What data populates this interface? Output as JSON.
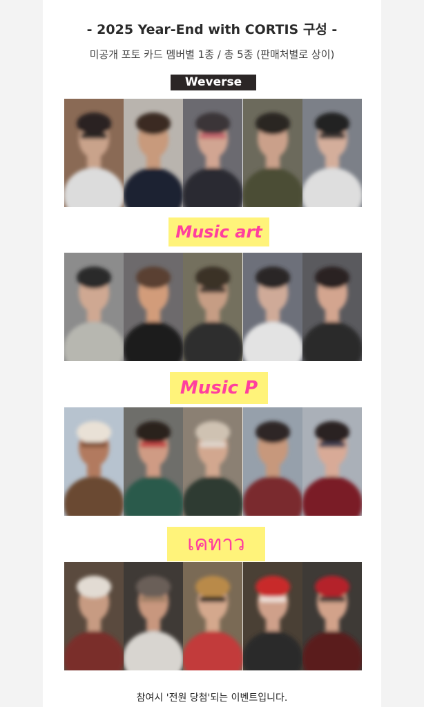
{
  "title": "- 2025 Year-End with CORTIS 구성 -",
  "subtitle": "미공개 포토 카드 멤버별 1종 / 총 5종 (판매처별로 상이)",
  "sections": [
    {
      "label": "Weverse"
    },
    {
      "label": "Music art"
    },
    {
      "label": "Music P"
    },
    {
      "label": "เคทาว"
    }
  ],
  "footer": "참여시 '전원 당첨'되는 이벤트입니다.",
  "colors": {
    "label_bg": "#fff37a",
    "label_text": "#ff3f9e",
    "weverse_bg": "#2b2626"
  },
  "photos": {
    "row1": [
      {
        "bg": "#8a6a55",
        "skin": "#c9a38b",
        "hair": "#2a2320",
        "cloth": "#dcdcdc",
        "extra": "#111"
      },
      {
        "bg": "#b9b4ae",
        "skin": "#c89a7c",
        "hair": "#3a2c22",
        "cloth": "#1d2030",
        "extra": ""
      },
      {
        "bg": "#6b6a70",
        "skin": "#d1a592",
        "hair": "#3b3437",
        "cloth": "#2a2b33",
        "extra": "#c05a66"
      },
      {
        "bg": "#6c6a5c",
        "skin": "#caa08a",
        "hair": "#2b2520",
        "cloth": "#4c4d36",
        "extra": ""
      },
      {
        "bg": "#7c8088",
        "skin": "#d4ae9b",
        "hair": "#222",
        "cloth": "#dedede",
        "extra": "#222"
      }
    ],
    "row2": [
      {
        "bg": "#8c8c8c",
        "skin": "#cfa892",
        "hair": "#2a2a2a",
        "cloth": "#b7b7b0",
        "extra": ""
      },
      {
        "bg": "#6d6a6c",
        "skin": "#d29c7a",
        "hair": "#5a4030",
        "cloth": "#1a1a1a",
        "extra": ""
      },
      {
        "bg": "#74705e",
        "skin": "#c69d84",
        "hair": "#3b3028",
        "cloth": "#2d2d2d",
        "extra": "#2a2521"
      },
      {
        "bg": "#6d707a",
        "skin": "#cfaa98",
        "hair": "#2a2626",
        "cloth": "#e3e3e3",
        "extra": ""
      },
      {
        "bg": "#5a5a5e",
        "skin": "#d3a58f",
        "hair": "#2a2222",
        "cloth": "#2b2b2b",
        "extra": ""
      }
    ],
    "row3": [
      {
        "bg": "#b7c3cf",
        "skin": "#b27a5e",
        "hair": "#e9e1d6",
        "cloth": "#6a4a33",
        "extra": "#7a4e33"
      },
      {
        "bg": "#6e6e6a",
        "skin": "#cf9b84",
        "hair": "#2a201c",
        "cloth": "#2c5a4b",
        "extra": "#c0383a"
      },
      {
        "bg": "#8b8073",
        "skin": "#d2a78f",
        "hair": "#cfc2b2",
        "cloth": "#2f3a33",
        "extra": "#e2ddd6"
      },
      {
        "bg": "#96a0ab",
        "skin": "#c7987c",
        "hair": "#2d2626",
        "cloth": "#7a2a2e",
        "extra": ""
      },
      {
        "bg": "#aab0b8",
        "skin": "#d8aa97",
        "hair": "#2a2020",
        "cloth": "#7a1f28",
        "extra": "#2a2f4a"
      }
    ],
    "row4": [
      {
        "bg": "#5a4a3e",
        "skin": "#c79b82",
        "hair": "#e2dbd3",
        "cloth": "#7a2f2a",
        "extra": ""
      },
      {
        "bg": "#3f3a36",
        "skin": "#c8977e",
        "hair": "#6a5f58",
        "cloth": "#d8d5d0",
        "extra": "#9a7a60"
      },
      {
        "bg": "#7a6a55",
        "skin": "#d4a88d",
        "hair": "#b98a4a",
        "cloth": "#c23a3a",
        "extra": "#111"
      },
      {
        "bg": "#4a4035",
        "skin": "#cfa08a",
        "hair": "#c82a2a",
        "cloth": "#2a2a2a",
        "extra": "#f2eee8"
      },
      {
        "bg": "#3e3a36",
        "skin": "#d2a28a",
        "hair": "#b4222a",
        "cloth": "#5a1a1e",
        "extra": "#2a2a2a"
      }
    ]
  }
}
